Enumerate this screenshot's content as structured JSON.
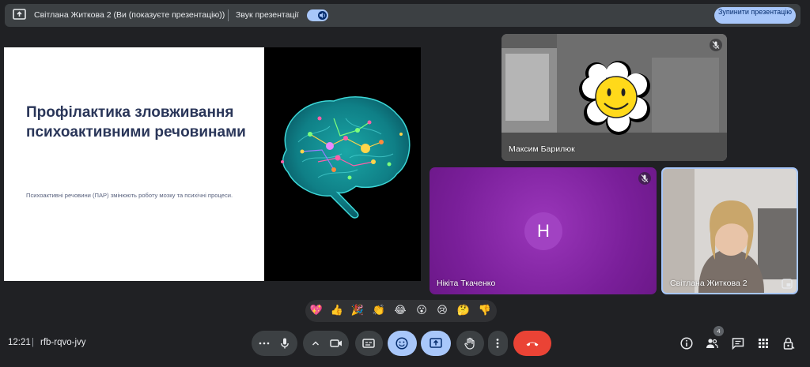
{
  "topbar": {
    "presenting_label": "Світлана Житкова 2 (Ви (показуєте презентацію))",
    "audio_label": "Звук презентації",
    "audio_enabled": true,
    "stop_button_label": "Зупинити презентацію"
  },
  "slide": {
    "title": "Профілактика зловживання психоактивними речовинами",
    "subtitle": "Психоактивні речовини (ПАР) змінюють роботу мозку та психічні процеси."
  },
  "participants": [
    {
      "name": "Максим Барилюк",
      "muted": true,
      "video": "camera-with-smiley-flower-overlay"
    },
    {
      "name": "Нікіта Ткаченко",
      "muted": true,
      "avatar_letter": "H",
      "avatar_color": "#a142c2"
    },
    {
      "name": "Світлана Житкова 2",
      "muted": false,
      "video": "camera"
    }
  ],
  "reactions": [
    "💖",
    "👍",
    "🎉",
    "👏",
    "😂",
    "😮",
    "😢",
    "🤔",
    "👎"
  ],
  "bottombar": {
    "time": "12:21",
    "separator": "|",
    "meeting_code": "rfb-rqvo-jvy",
    "participant_count": "4"
  },
  "colors": {
    "background": "#202124",
    "accent": "#a8c7fa",
    "end_call": "#ea4335",
    "slide_title": "#2a3659"
  }
}
